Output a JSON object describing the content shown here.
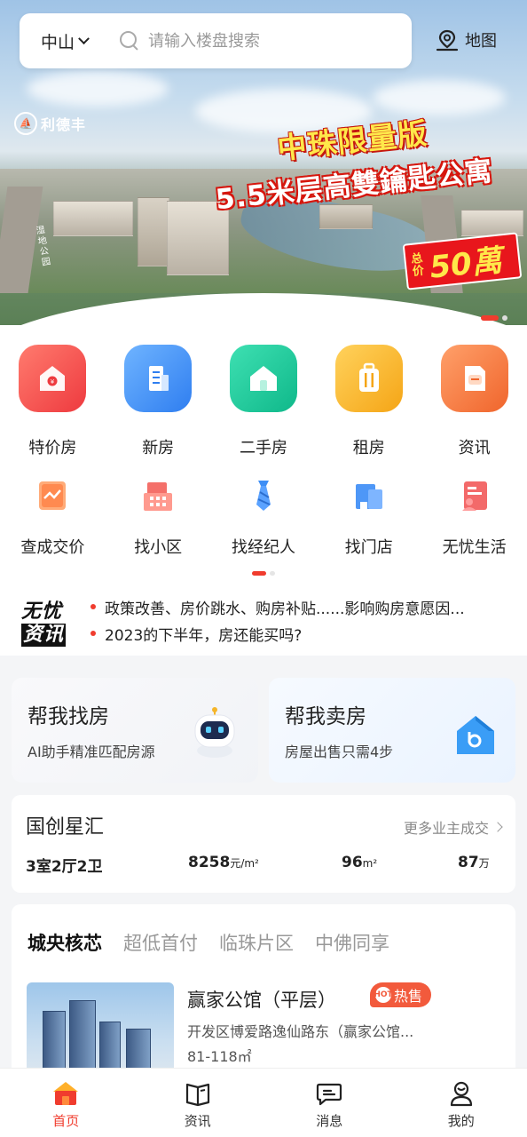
{
  "search": {
    "city": "中山",
    "placeholder": "请输入楼盘搜索",
    "map_label": "地图"
  },
  "banner": {
    "logo_text": "利德丰",
    "headline": "中珠限量版",
    "subheadline": "5.5米层高雙鑰匙公寓",
    "price_label": "总价",
    "price_value": "50萬",
    "side_label": "湿地公园",
    "slide_count": 2,
    "active_slide": 1
  },
  "categories_main": [
    {
      "label": "特价房",
      "icon": "discount-house-icon",
      "color": "#f04848"
    },
    {
      "label": "新房",
      "icon": "building-icon",
      "color": "#3f8ff0"
    },
    {
      "label": "二手房",
      "icon": "home-icon",
      "color": "#18c59a"
    },
    {
      "label": "租房",
      "icon": "suitcase-icon",
      "color": "#f7b52a"
    },
    {
      "label": "资讯",
      "icon": "document-icon",
      "color": "#f27a3a"
    }
  ],
  "categories_sub": [
    {
      "label": "查成交价",
      "icon": "price-chart-icon"
    },
    {
      "label": "找小区",
      "icon": "community-icon"
    },
    {
      "label": "找经纪人",
      "icon": "agent-tie-icon"
    },
    {
      "label": "找门店",
      "icon": "store-icon"
    },
    {
      "label": "无忧生活",
      "icon": "life-service-icon"
    }
  ],
  "news": {
    "logo_line1": "无忧",
    "logo_line2": "资讯",
    "items": [
      "政策改善、房价跳水、购房补贴......影响购房意愿因...",
      "2023的下半年，房还能买吗?"
    ]
  },
  "help": {
    "find": {
      "title": "帮我找房",
      "subtitle": "AI助手精准匹配房源"
    },
    "sell": {
      "title": "帮我卖房",
      "subtitle": "房屋出售只需4步"
    }
  },
  "deal": {
    "name": "国创星汇",
    "more_label": "更多业主成交",
    "layout": "3室2厅2卫",
    "unit_price": "8258",
    "unit_price_unit": "元/m²",
    "area": "96",
    "area_unit": "m²",
    "total": "87",
    "total_unit": "万"
  },
  "projects": {
    "tabs": [
      "城央核芯",
      "超低首付",
      "临珠片区",
      "中佛同享"
    ],
    "active_tab": 0,
    "item": {
      "title": "赢家公馆（平层）",
      "badge": "热售",
      "badge_icon_text": "HOT",
      "address": "开发区博爱路逸仙路东（赢家公馆...",
      "area": "81-118㎡"
    }
  },
  "bottom_nav": [
    {
      "label": "首页",
      "icon": "home-nav-icon",
      "active": true
    },
    {
      "label": "资讯",
      "icon": "news-book-icon",
      "active": false
    },
    {
      "label": "消息",
      "icon": "message-icon",
      "active": false
    },
    {
      "label": "我的",
      "icon": "profile-icon",
      "active": false
    }
  ],
  "colors": {
    "accent": "#f03c2e",
    "text": "#222222",
    "muted": "#999999"
  }
}
